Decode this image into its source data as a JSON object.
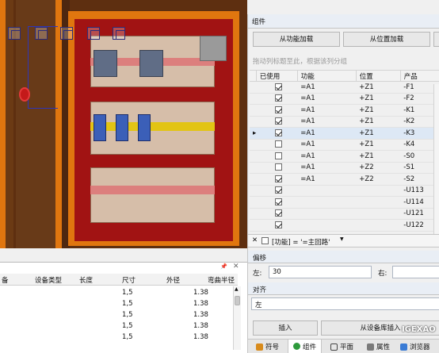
{
  "side": {
    "title": "组件",
    "btn_load_function": "从功能加载",
    "btn_load_position": "从位置加载",
    "group_hint": "拖动列标题至此，根据该列分组",
    "columns": [
      "已使用",
      "功能",
      "位置",
      "产品"
    ],
    "rows": [
      {
        "used": true,
        "func": "=A1",
        "pos": "+Z1",
        "prod": "-F1"
      },
      {
        "used": true,
        "func": "=A1",
        "pos": "+Z1",
        "prod": "-F2"
      },
      {
        "used": true,
        "func": "=A1",
        "pos": "+Z1",
        "prod": "-K1"
      },
      {
        "used": true,
        "func": "=A1",
        "pos": "+Z1",
        "prod": "-K2"
      },
      {
        "used": true,
        "func": "=A1",
        "pos": "+Z1",
        "prod": "-K3"
      },
      {
        "used": false,
        "func": "=A1",
        "pos": "+Z1",
        "prod": "-K4"
      },
      {
        "used": false,
        "func": "=A1",
        "pos": "+Z1",
        "prod": "-S0"
      },
      {
        "used": false,
        "func": "=A1",
        "pos": "+Z2",
        "prod": "-S1"
      },
      {
        "used": true,
        "func": "=A1",
        "pos": "+Z2",
        "prod": "-S2"
      },
      {
        "used": true,
        "func": "",
        "pos": "",
        "prod": "-U113"
      },
      {
        "used": true,
        "func": "",
        "pos": "",
        "prod": "-U114"
      },
      {
        "used": true,
        "func": "",
        "pos": "",
        "prod": "-U121"
      },
      {
        "used": true,
        "func": "",
        "pos": "",
        "prod": "-U122"
      }
    ],
    "filter_text": "[功能] = '=主回路'",
    "offset_title": "偏移",
    "left_label": "左:",
    "left_value": "30",
    "right_label": "右:",
    "align_title": "对齐",
    "align_value": "左",
    "btn_insert": "插入",
    "btn_insert_library": "从设备库插入"
  },
  "tabs": [
    "符号",
    "组件",
    "平面",
    "属性",
    "浏览器"
  ],
  "watermark": "IGEXAO",
  "bottom": {
    "columns": [
      "备",
      "设备类型",
      "长度",
      "尺寸",
      "外径",
      "弯曲半径"
    ],
    "rows": [
      {
        "size": "1,5",
        "od": "1.38"
      },
      {
        "size": "1,5",
        "od": "1.38"
      },
      {
        "size": "1,5",
        "od": "1.38"
      },
      {
        "size": "1,5",
        "od": "1.38"
      },
      {
        "size": "1,5",
        "od": "1.38"
      }
    ]
  }
}
